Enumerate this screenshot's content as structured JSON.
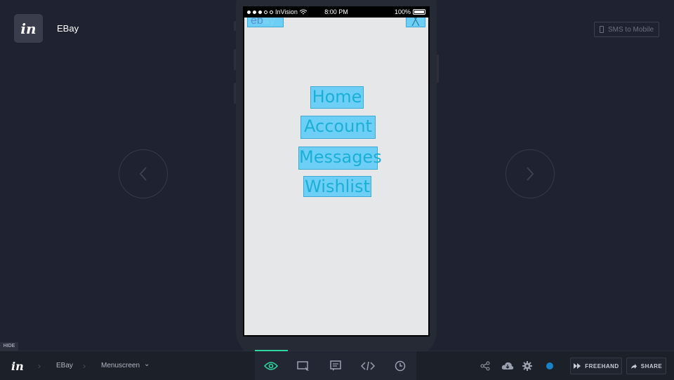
{
  "header": {
    "project_name": "EBay",
    "sms_label": "SMS to Mobile"
  },
  "statusbar": {
    "carrier": "InVision",
    "time": "8:00 PM",
    "battery": "100%"
  },
  "app": {
    "brand": {
      "prefix": "eb",
      "suffix": "ay"
    },
    "close_glyph": "╳",
    "menu": [
      "Home",
      "Account",
      "Messages",
      "Wishlist"
    ]
  },
  "hide_label": "HIDE",
  "bottom": {
    "crumbs": [
      "EBay",
      "Menuscreen"
    ],
    "crumb_caret": "⌄",
    "freehand_label": "FREEHAND",
    "share_label": "SHARE"
  },
  "colors": {
    "accent": "#2fd7a0",
    "status_dot": "#1783c6",
    "hotspot": "#6dcff6"
  }
}
